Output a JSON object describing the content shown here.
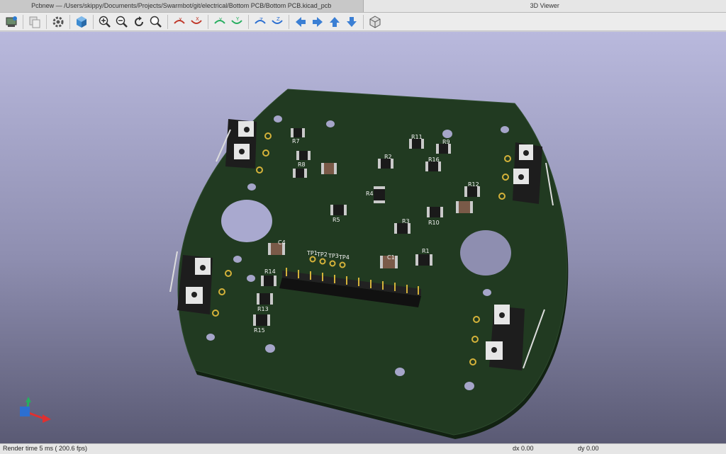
{
  "tabs": [
    {
      "label": "Pcbnew — /Users/skippy/Documents/Projects/Swarmbot/git/electrical/Bottom PCB/Bottom PCB.kicad_pcb"
    },
    {
      "label": "3D Viewer"
    }
  ],
  "toolbar": {
    "buttons": [
      "reload-board-icon",
      "copy-image-icon",
      "settings-icon",
      "render-3d-icon",
      "zoom-in-icon",
      "zoom-out-icon",
      "redraw-icon",
      "zoom-fit-icon",
      "rotate-x-cw-icon",
      "rotate-x-ccw-icon",
      "rotate-y-cw-icon",
      "rotate-y-ccw-icon",
      "rotate-z-cw-icon",
      "rotate-z-ccw-icon",
      "move-left-icon",
      "move-right-icon",
      "move-up-icon",
      "move-down-icon",
      "ortho-icon"
    ],
    "labels": {
      "x": "X",
      "y": "Y",
      "z": "Z"
    }
  },
  "board": {
    "labels": [
      "R7",
      "R8",
      "R11",
      "R9",
      "R2",
      "R16",
      "R4",
      "R12",
      "R5",
      "R3",
      "R10",
      "R1",
      "C1",
      "C4",
      "TP1",
      "TP2",
      "TP3",
      "TP4",
      "R14",
      "R13",
      "R15",
      "SW"
    ],
    "colors": {
      "solder_mask": "#213a21",
      "pad": "#c9c9c9",
      "silkscreen": "#f2f2f2",
      "gold": "#d4b23a"
    }
  },
  "status": {
    "render_time": "Render time 5 ms ( 200.6 fps)",
    "dx": "dx 0.00",
    "dy": "dy 0.00"
  }
}
